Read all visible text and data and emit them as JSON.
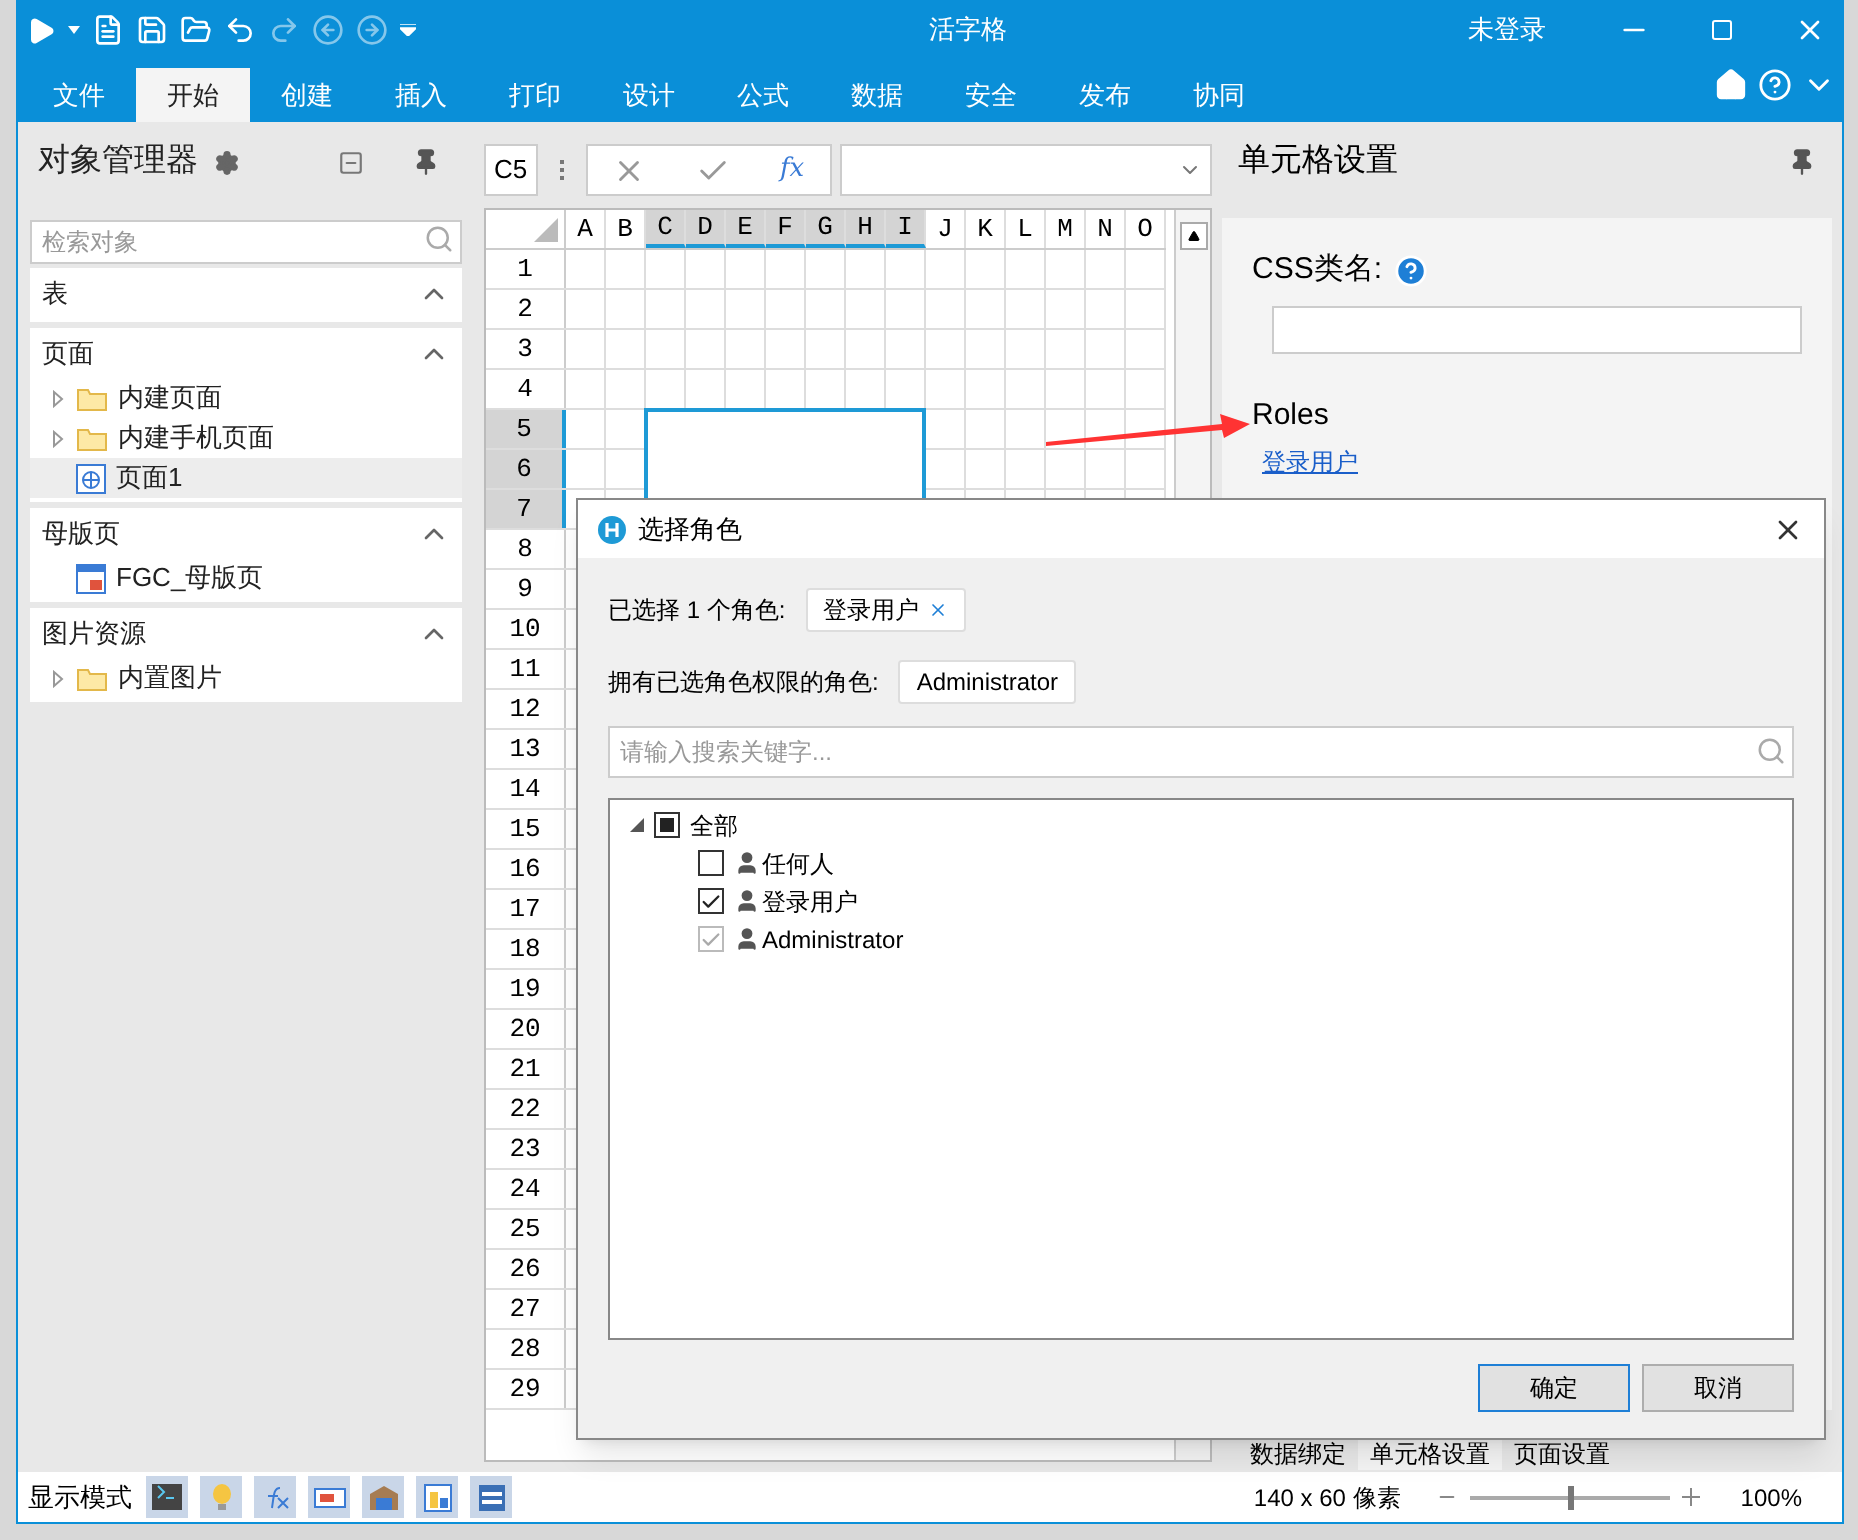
{
  "window": {
    "title": "活字格",
    "user": "未登录"
  },
  "ribbon_tabs": [
    {
      "label": "文件",
      "selected": false
    },
    {
      "label": "开始",
      "selected": true
    },
    {
      "label": "创建",
      "selected": false
    },
    {
      "label": "插入",
      "selected": false
    },
    {
      "label": "打印",
      "selected": false
    },
    {
      "label": "设计",
      "selected": false
    },
    {
      "label": "公式",
      "selected": false
    },
    {
      "label": "数据",
      "selected": false
    },
    {
      "label": "安全",
      "selected": false
    },
    {
      "label": "发布",
      "selected": false
    },
    {
      "label": "协同",
      "selected": false
    }
  ],
  "object_manager": {
    "title": "对象管理器",
    "search": {
      "placeholder": "检索对象"
    },
    "sections": [
      {
        "title": "表",
        "expanded": true
      },
      {
        "title": "页面",
        "expanded": true,
        "items": [
          {
            "label": "内建页面",
            "kind": "folder",
            "selected": false
          },
          {
            "label": "内建手机页面",
            "kind": "folder",
            "selected": false
          },
          {
            "label": "页面1",
            "kind": "page",
            "selected": true
          }
        ]
      },
      {
        "title": "母版页",
        "expanded": true,
        "items": [
          {
            "label": "FGC_母版页",
            "kind": "master",
            "selected": false
          }
        ]
      },
      {
        "title": "图片资源",
        "expanded": true,
        "items": [
          {
            "label": "内置图片",
            "kind": "folder",
            "selected": false
          }
        ]
      }
    ]
  },
  "formula_bar": {
    "cell_ref": "C5",
    "function_label": "fx"
  },
  "grid": {
    "columns": [
      {
        "label": "A",
        "selected": false
      },
      {
        "label": "B",
        "selected": false
      },
      {
        "label": "C",
        "selected": true
      },
      {
        "label": "D",
        "selected": true
      },
      {
        "label": "E",
        "selected": true
      },
      {
        "label": "F",
        "selected": true
      },
      {
        "label": "G",
        "selected": true
      },
      {
        "label": "H",
        "selected": true
      },
      {
        "label": "I",
        "selected": true
      },
      {
        "label": "J",
        "selected": false
      },
      {
        "label": "K",
        "selected": false
      },
      {
        "label": "L",
        "selected": false
      },
      {
        "label": "M",
        "selected": false
      },
      {
        "label": "N",
        "selected": false
      },
      {
        "label": "O",
        "selected": false
      }
    ],
    "rows": [
      {
        "label": "1",
        "selected": false
      },
      {
        "label": "2",
        "selected": false
      },
      {
        "label": "3",
        "selected": false
      },
      {
        "label": "4",
        "selected": false
      },
      {
        "label": "5",
        "selected": true
      },
      {
        "label": "6",
        "selected": true
      },
      {
        "label": "7",
        "selected": true
      },
      {
        "label": "8",
        "selected": false
      },
      {
        "label": "9",
        "selected": false
      },
      {
        "label": "10",
        "selected": false
      },
      {
        "label": "11",
        "selected": false
      },
      {
        "label": "12",
        "selected": false
      },
      {
        "label": "13",
        "selected": false
      },
      {
        "label": "14",
        "selected": false
      },
      {
        "label": "15",
        "selected": false
      },
      {
        "label": "16",
        "selected": false
      },
      {
        "label": "17",
        "selected": false
      },
      {
        "label": "18",
        "selected": false
      },
      {
        "label": "19",
        "selected": false
      },
      {
        "label": "20",
        "selected": false
      },
      {
        "label": "21",
        "selected": false
      },
      {
        "label": "22",
        "selected": false
      },
      {
        "label": "23",
        "selected": false
      },
      {
        "label": "24",
        "selected": false
      },
      {
        "label": "25",
        "selected": false
      },
      {
        "label": "26",
        "selected": false
      },
      {
        "label": "27",
        "selected": false
      },
      {
        "label": "28",
        "selected": false
      },
      {
        "label": "29",
        "selected": false
      }
    ]
  },
  "cell_settings": {
    "title": "单元格设置",
    "css_label": "CSS类名:",
    "roles_label": "Roles",
    "roles_link": "登录用户"
  },
  "bottom_tabs": [
    {
      "label": "数据绑定",
      "selected": false
    },
    {
      "label": "单元格设置",
      "selected": true
    },
    {
      "label": "页面设置",
      "selected": false
    }
  ],
  "status_bar": {
    "display_mode_label": "显示模式",
    "size": "140 x 60 像素",
    "zoom": {
      "level": 0.5
    },
    "zoom_reading": "100%"
  },
  "dialog": {
    "title": "选择角色",
    "selected_label": "已选择 1 个角色:",
    "selected_tags": [
      "登录用户"
    ],
    "inherited_label": "拥有已选角色权限的角色:",
    "inherited_tags": [
      "Administrator"
    ],
    "search": {
      "placeholder": "请输入搜索关键字..."
    },
    "tree": {
      "label": "全部",
      "expanded": true,
      "partial": true,
      "children": [
        {
          "label": "任何人",
          "checked": false,
          "disabled": false
        },
        {
          "label": "登录用户",
          "checked": true,
          "disabled": false
        },
        {
          "label": "Administrator",
          "checked": true,
          "disabled": true
        }
      ]
    },
    "buttons": [
      {
        "label": "确定",
        "kind": "primary"
      },
      {
        "label": "取消",
        "kind": "default"
      }
    ]
  }
}
